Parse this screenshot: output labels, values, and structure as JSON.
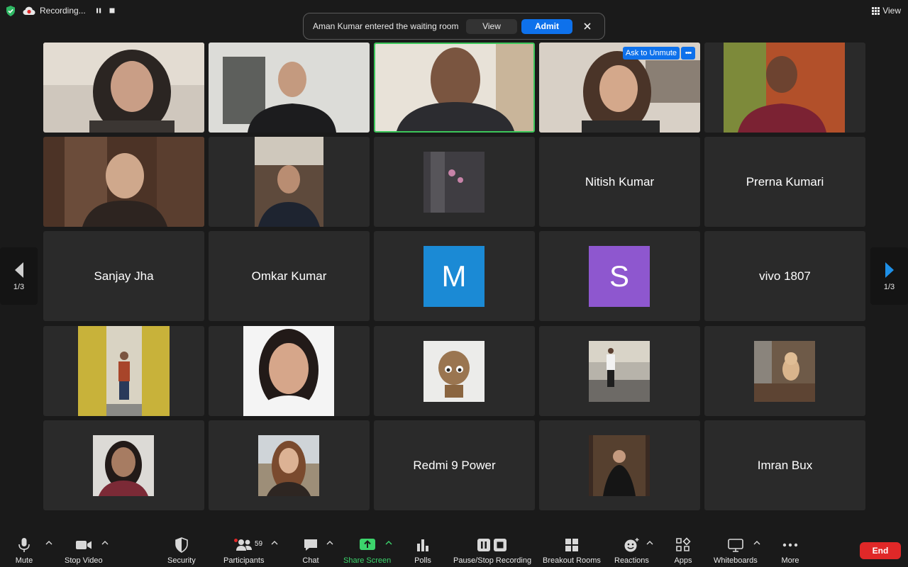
{
  "topbar": {
    "recording_label": "Recording...",
    "view_label": "View"
  },
  "notification": {
    "message": "Aman Kumar entered the waiting room",
    "view_label": "View",
    "admit_label": "Admit"
  },
  "tiles": {
    "t4_ask_unmute": "Ask to Unmute",
    "t4_more": "•••",
    "t9_name": "Nitish Kumar",
    "t10_name": "Prerna Kumari",
    "t11_name": "Sanjay Jha",
    "t12_name": "Omkar Kumar",
    "t13_letter": "M",
    "t14_letter": "S",
    "t15_name": "vivo 1807",
    "t23_name": "Redmi 9 Power",
    "t25_name": "Imran Bux"
  },
  "colors": {
    "avatar_m": "#1b8ad5",
    "avatar_s": "#8e57cf",
    "admit": "#0e71eb",
    "end": "#e02828",
    "share_screen": "#3cd46c"
  },
  "pagination": {
    "left_label": "1/3",
    "right_label": "1/3"
  },
  "toolbar": {
    "mute": "Mute",
    "stop_video": "Stop Video",
    "security": "Security",
    "participants": "Participants",
    "participants_count": "59",
    "chat": "Chat",
    "share_screen": "Share Screen",
    "polls": "Polls",
    "pause_stop_recording": "Pause/Stop Recording",
    "breakout_rooms": "Breakout Rooms",
    "reactions": "Reactions",
    "apps": "Apps",
    "whiteboards": "Whiteboards",
    "more": "More",
    "end": "End"
  }
}
